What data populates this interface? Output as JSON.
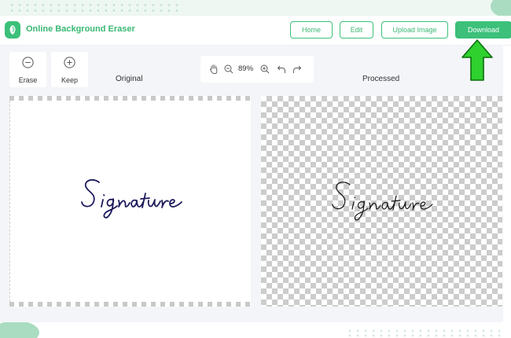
{
  "app": {
    "title": "Online Background Eraser",
    "accent_color": "#3cc07a"
  },
  "header": {
    "nav": [
      {
        "label": "Home"
      },
      {
        "label": "Edit"
      },
      {
        "label": "Upload Image"
      },
      {
        "label": "Download"
      }
    ]
  },
  "tools": {
    "erase_label": "Erase",
    "keep_label": "Keep",
    "erase_icon": "minus-circle-icon",
    "keep_icon": "plus-circle-icon"
  },
  "zoom": {
    "value": "89%",
    "icons": [
      "hand-icon",
      "zoom-out-icon",
      "zoom-in-icon",
      "undo-icon",
      "redo-icon"
    ]
  },
  "panels": {
    "original_label": "Original",
    "processed_label": "Processed"
  },
  "image": {
    "signature_text": "Signature"
  },
  "annotation": {
    "arrow_color": "#2fd12f",
    "arrow_icon": "green-up-arrow-icon"
  }
}
